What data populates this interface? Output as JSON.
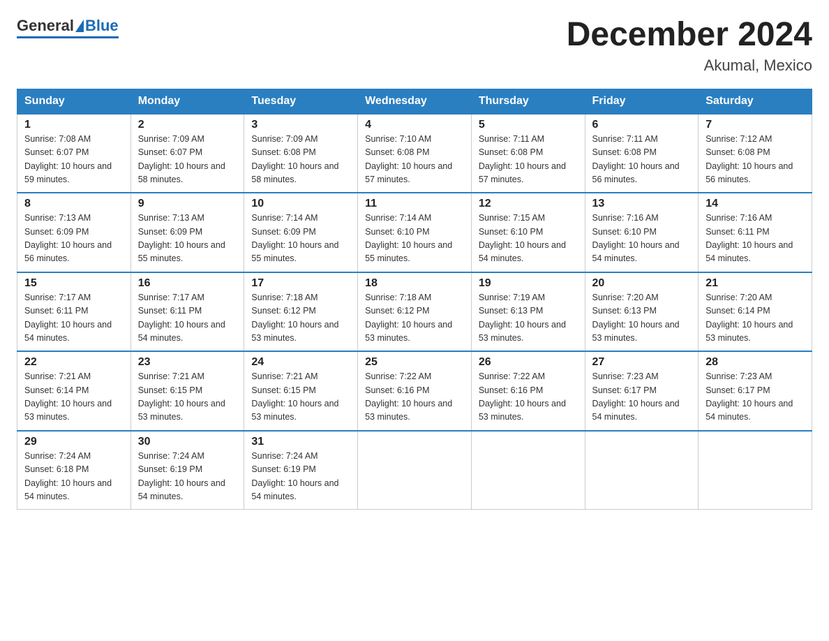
{
  "header": {
    "logo_general": "General",
    "logo_blue": "Blue",
    "month_title": "December 2024",
    "location": "Akumal, Mexico"
  },
  "days_of_week": [
    "Sunday",
    "Monday",
    "Tuesday",
    "Wednesday",
    "Thursday",
    "Friday",
    "Saturday"
  ],
  "weeks": [
    [
      {
        "day": 1,
        "sunrise": "7:08 AM",
        "sunset": "6:07 PM",
        "daylight": "10 hours and 59 minutes."
      },
      {
        "day": 2,
        "sunrise": "7:09 AM",
        "sunset": "6:07 PM",
        "daylight": "10 hours and 58 minutes."
      },
      {
        "day": 3,
        "sunrise": "7:09 AM",
        "sunset": "6:08 PM",
        "daylight": "10 hours and 58 minutes."
      },
      {
        "day": 4,
        "sunrise": "7:10 AM",
        "sunset": "6:08 PM",
        "daylight": "10 hours and 57 minutes."
      },
      {
        "day": 5,
        "sunrise": "7:11 AM",
        "sunset": "6:08 PM",
        "daylight": "10 hours and 57 minutes."
      },
      {
        "day": 6,
        "sunrise": "7:11 AM",
        "sunset": "6:08 PM",
        "daylight": "10 hours and 56 minutes."
      },
      {
        "day": 7,
        "sunrise": "7:12 AM",
        "sunset": "6:08 PM",
        "daylight": "10 hours and 56 minutes."
      }
    ],
    [
      {
        "day": 8,
        "sunrise": "7:13 AM",
        "sunset": "6:09 PM",
        "daylight": "10 hours and 56 minutes."
      },
      {
        "day": 9,
        "sunrise": "7:13 AM",
        "sunset": "6:09 PM",
        "daylight": "10 hours and 55 minutes."
      },
      {
        "day": 10,
        "sunrise": "7:14 AM",
        "sunset": "6:09 PM",
        "daylight": "10 hours and 55 minutes."
      },
      {
        "day": 11,
        "sunrise": "7:14 AM",
        "sunset": "6:10 PM",
        "daylight": "10 hours and 55 minutes."
      },
      {
        "day": 12,
        "sunrise": "7:15 AM",
        "sunset": "6:10 PM",
        "daylight": "10 hours and 54 minutes."
      },
      {
        "day": 13,
        "sunrise": "7:16 AM",
        "sunset": "6:10 PM",
        "daylight": "10 hours and 54 minutes."
      },
      {
        "day": 14,
        "sunrise": "7:16 AM",
        "sunset": "6:11 PM",
        "daylight": "10 hours and 54 minutes."
      }
    ],
    [
      {
        "day": 15,
        "sunrise": "7:17 AM",
        "sunset": "6:11 PM",
        "daylight": "10 hours and 54 minutes."
      },
      {
        "day": 16,
        "sunrise": "7:17 AM",
        "sunset": "6:11 PM",
        "daylight": "10 hours and 54 minutes."
      },
      {
        "day": 17,
        "sunrise": "7:18 AM",
        "sunset": "6:12 PM",
        "daylight": "10 hours and 53 minutes."
      },
      {
        "day": 18,
        "sunrise": "7:18 AM",
        "sunset": "6:12 PM",
        "daylight": "10 hours and 53 minutes."
      },
      {
        "day": 19,
        "sunrise": "7:19 AM",
        "sunset": "6:13 PM",
        "daylight": "10 hours and 53 minutes."
      },
      {
        "day": 20,
        "sunrise": "7:20 AM",
        "sunset": "6:13 PM",
        "daylight": "10 hours and 53 minutes."
      },
      {
        "day": 21,
        "sunrise": "7:20 AM",
        "sunset": "6:14 PM",
        "daylight": "10 hours and 53 minutes."
      }
    ],
    [
      {
        "day": 22,
        "sunrise": "7:21 AM",
        "sunset": "6:14 PM",
        "daylight": "10 hours and 53 minutes."
      },
      {
        "day": 23,
        "sunrise": "7:21 AM",
        "sunset": "6:15 PM",
        "daylight": "10 hours and 53 minutes."
      },
      {
        "day": 24,
        "sunrise": "7:21 AM",
        "sunset": "6:15 PM",
        "daylight": "10 hours and 53 minutes."
      },
      {
        "day": 25,
        "sunrise": "7:22 AM",
        "sunset": "6:16 PM",
        "daylight": "10 hours and 53 minutes."
      },
      {
        "day": 26,
        "sunrise": "7:22 AM",
        "sunset": "6:16 PM",
        "daylight": "10 hours and 53 minutes."
      },
      {
        "day": 27,
        "sunrise": "7:23 AM",
        "sunset": "6:17 PM",
        "daylight": "10 hours and 54 minutes."
      },
      {
        "day": 28,
        "sunrise": "7:23 AM",
        "sunset": "6:17 PM",
        "daylight": "10 hours and 54 minutes."
      }
    ],
    [
      {
        "day": 29,
        "sunrise": "7:24 AM",
        "sunset": "6:18 PM",
        "daylight": "10 hours and 54 minutes."
      },
      {
        "day": 30,
        "sunrise": "7:24 AM",
        "sunset": "6:19 PM",
        "daylight": "10 hours and 54 minutes."
      },
      {
        "day": 31,
        "sunrise": "7:24 AM",
        "sunset": "6:19 PM",
        "daylight": "10 hours and 54 minutes."
      },
      null,
      null,
      null,
      null
    ]
  ]
}
